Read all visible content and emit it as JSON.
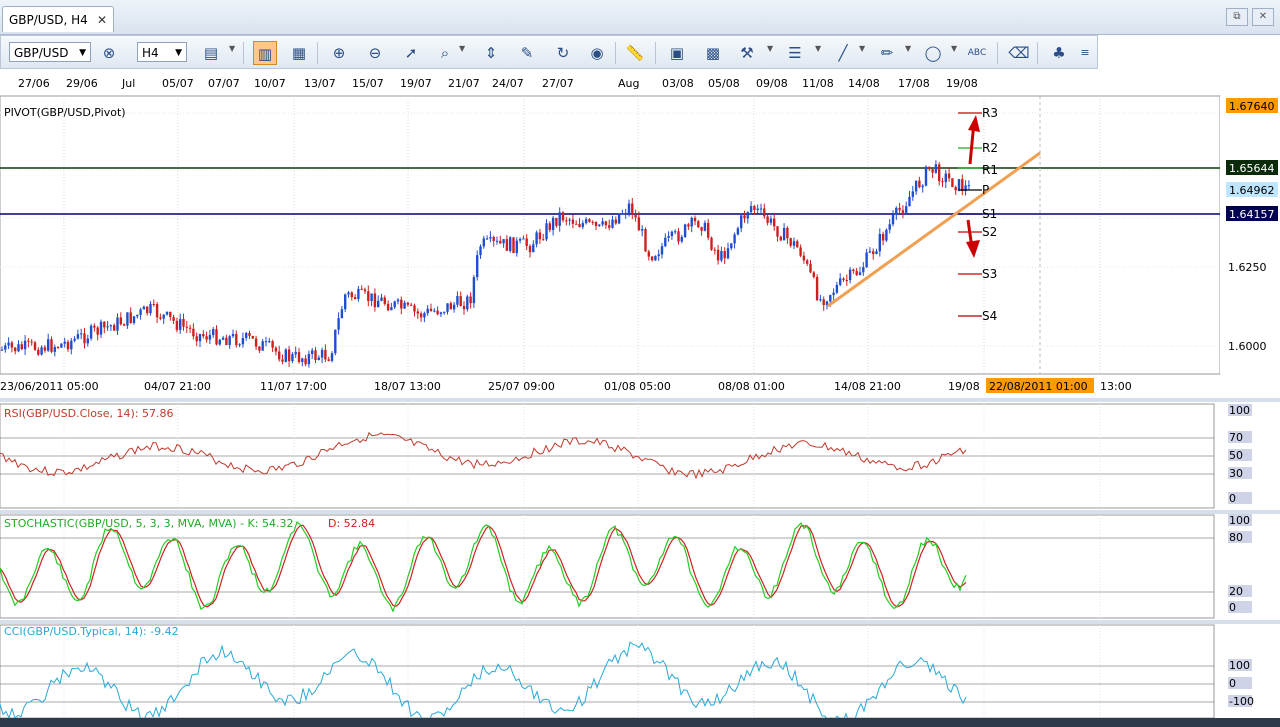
{
  "tab": {
    "title": "GBP/USD, H4",
    "close": "✕"
  },
  "window": {
    "restore": "⧉",
    "close": "✕"
  },
  "toolbar": {
    "symbol": "GBP/USD",
    "timeframe": "H4",
    "dropdown_arrow": "▼"
  },
  "top_dates": [
    "27/06",
    "29/06",
    "Jul",
    "05/07",
    "07/07",
    "10/07",
    "13/07",
    "15/07",
    "19/07",
    "21/07",
    "24/07",
    "27/07",
    "Aug",
    "03/08",
    "05/08",
    "09/08",
    "11/08",
    "14/08",
    "17/08",
    "19/08"
  ],
  "bottom_dates": [
    "23/06/2011 05:00",
    "04/07 21:00",
    "11/07 17:00",
    "18/07 13:00",
    "25/07 09:00",
    "01/08 05:00",
    "08/08 01:00",
    "14/08 21:00",
    "19/08"
  ],
  "cursor_date": "22/08/2011 01:00",
  "cursor_after": "13:00",
  "price_panel": {
    "label": "PIVOT(GBP/USD,Pivot)",
    "axis_ticks": [
      "1.6250",
      "1.6000"
    ],
    "price_tags": [
      {
        "value": "1.67640",
        "bg": "#ff9900",
        "fg": "#000000"
      },
      {
        "value": "1.65644",
        "bg": "#0a2a0a",
        "fg": "#ffffff"
      },
      {
        "value": "1.64962",
        "bg": "#bfe6ff",
        "fg": "#000000"
      },
      {
        "value": "1.64157",
        "bg": "#000050",
        "fg": "#ffffff"
      }
    ],
    "pivot_labels": [
      "R3",
      "R2",
      "R1",
      "P",
      "S1",
      "S2",
      "S3",
      "S4"
    ]
  },
  "rsi_panel": {
    "label": "RSI(GBP/USD.Close, 14): 57.86",
    "color": "#c0392b",
    "levels": [
      "100",
      "70",
      "50",
      "30",
      "0"
    ]
  },
  "stoch_panel": {
    "label_main": "STOCHASTIC(GBP/USD, 5, 3, 3, MVA, MVA) -  K: 54.32",
    "label_d": "D: 52.84",
    "k_color": "#22cc22",
    "d_color": "#cc2222",
    "levels": [
      "100",
      "80",
      "20",
      "0"
    ]
  },
  "cci_panel": {
    "label": "CCI(GBP/USD.Typical, 14): -9.42",
    "color": "#29a8d8",
    "levels": [
      "100",
      "0",
      "-100"
    ]
  }
}
